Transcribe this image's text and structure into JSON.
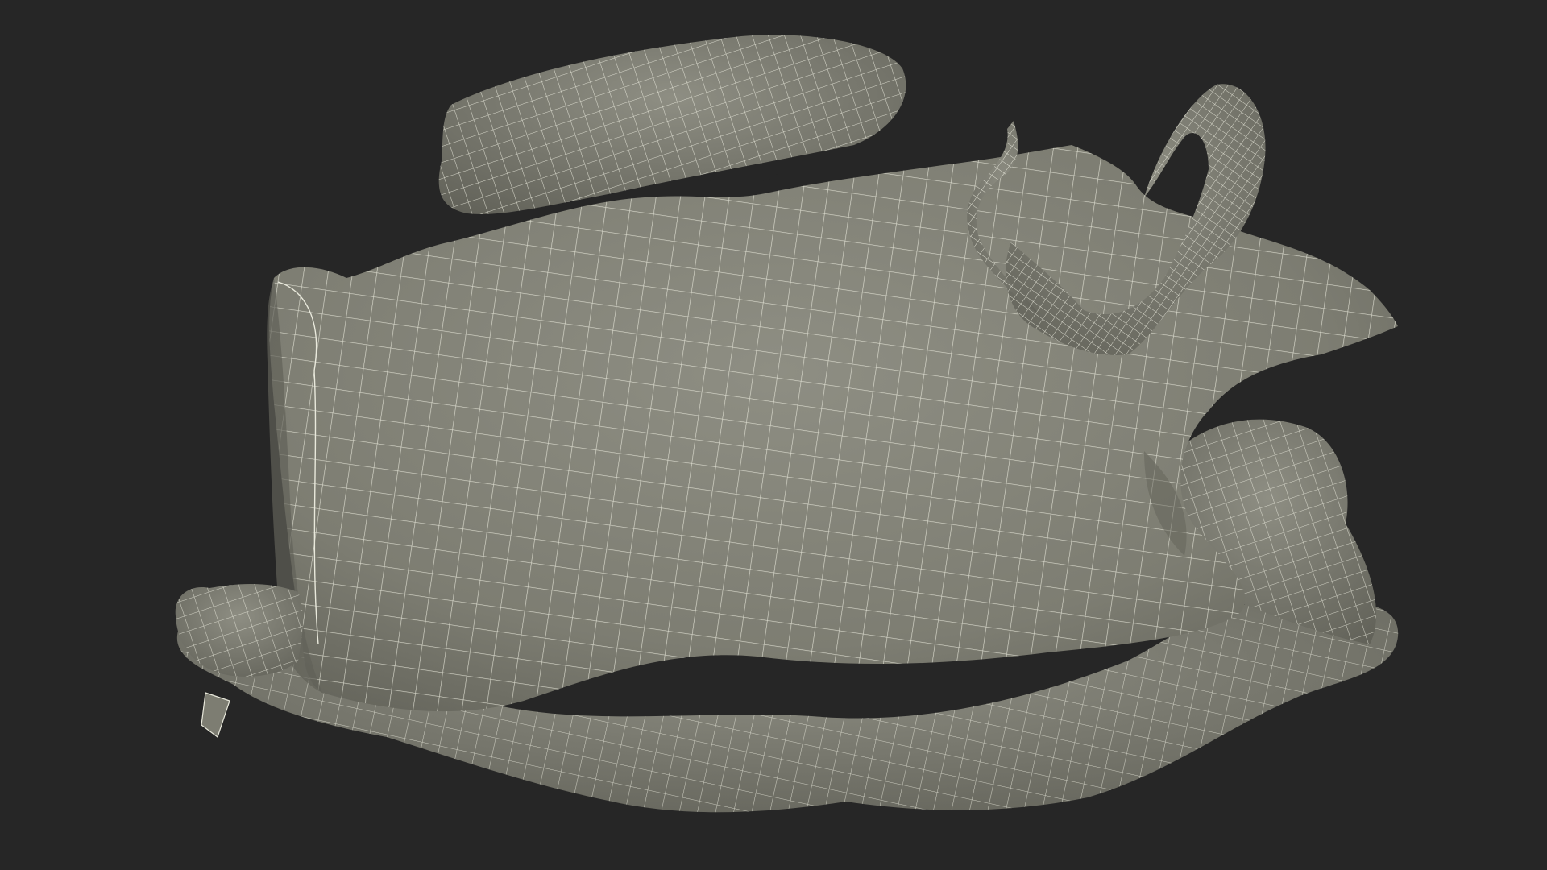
{
  "scene": {
    "background_color": "#262626",
    "model_fill_color": "#7d7d72",
    "model_shadow_color": "#616158",
    "model_highlight_color": "#8e8e83",
    "wireframe_color": "#e9e9dc",
    "object_icon": "crumpled-bag-wireframe-icon"
  }
}
